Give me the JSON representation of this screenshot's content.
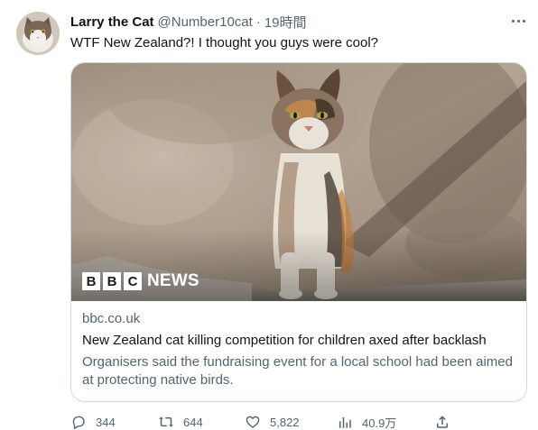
{
  "tweet": {
    "author_name": "Larry the Cat",
    "handle": "@Number10cat",
    "separator": "·",
    "time": "19時間",
    "text": "WTF New Zealand?! I thought you guys were cool?"
  },
  "card": {
    "image_overlay": {
      "bbc_letters": [
        "B",
        "B",
        "C"
      ],
      "news_word": "NEWS"
    },
    "domain": "bbc.co.uk",
    "title": "New Zealand cat killing competition for children axed after backlash",
    "description": "Organisers said the fundraising event for a local school had been aimed at protecting native birds."
  },
  "actions": {
    "replies": "344",
    "retweets": "644",
    "likes": "5,822",
    "views": "40.9万"
  },
  "colors": {
    "text_primary": "#0f1419",
    "text_secondary": "#536471",
    "card_border": "#cfd9de"
  },
  "icons": {
    "more": "more-horizontal-icon",
    "reply": "reply-icon",
    "retweet": "retweet-icon",
    "like": "heart-icon",
    "views": "bar-chart-icon",
    "share": "share-icon"
  }
}
